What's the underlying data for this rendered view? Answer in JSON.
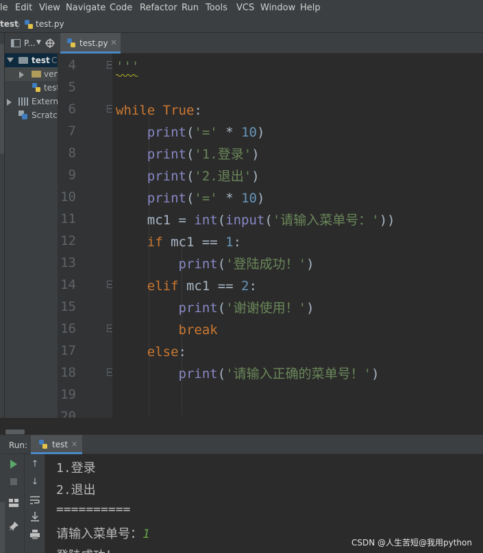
{
  "menu": [
    "le",
    "Edit",
    "View",
    "Navigate",
    "Code",
    "Refactor",
    "Run",
    "Tools",
    "VCS",
    "Window",
    "Help"
  ],
  "breadcrumb": {
    "project": "test",
    "file": "test.py"
  },
  "project_panel": {
    "header": "P...",
    "items": [
      {
        "label": "test",
        "suffix": "C",
        "level": 0,
        "expanded": true,
        "kind": "folder"
      },
      {
        "label": "ven",
        "level": 1,
        "expanded": false,
        "kind": "folder"
      },
      {
        "label": "test",
        "level": 2,
        "kind": "python-file"
      },
      {
        "label": "Extern",
        "level": 0,
        "expanded": false,
        "kind": "libraries"
      },
      {
        "label": "Scratch",
        "level": 0,
        "kind": "scratches"
      }
    ]
  },
  "editor": {
    "tab_label": "test.py",
    "lines": [
      {
        "num": "4",
        "tokens": [
          {
            "t": "'''",
            "c": "str"
          }
        ]
      },
      {
        "num": "5",
        "tokens": []
      },
      {
        "num": "6",
        "tokens": [
          {
            "t": "while ",
            "c": "kw"
          },
          {
            "t": "True",
            "c": "kw"
          },
          {
            "t": ":",
            "c": ""
          }
        ]
      },
      {
        "num": "7",
        "tokens": [
          {
            "t": "    ",
            "c": ""
          },
          {
            "t": "print",
            "c": "fn"
          },
          {
            "t": "(",
            "c": ""
          },
          {
            "t": "'='",
            "c": "str"
          },
          {
            "t": " * ",
            "c": ""
          },
          {
            "t": "10",
            "c": "num"
          },
          {
            "t": ")",
            "c": ""
          }
        ]
      },
      {
        "num": "8",
        "tokens": [
          {
            "t": "    ",
            "c": ""
          },
          {
            "t": "print",
            "c": "fn"
          },
          {
            "t": "(",
            "c": ""
          },
          {
            "t": "'1.登录'",
            "c": "str"
          },
          {
            "t": ")",
            "c": ""
          }
        ]
      },
      {
        "num": "9",
        "tokens": [
          {
            "t": "    ",
            "c": ""
          },
          {
            "t": "print",
            "c": "fn"
          },
          {
            "t": "(",
            "c": ""
          },
          {
            "t": "'2.退出'",
            "c": "str"
          },
          {
            "t": ")",
            "c": ""
          }
        ]
      },
      {
        "num": "10",
        "tokens": [
          {
            "t": "    ",
            "c": ""
          },
          {
            "t": "print",
            "c": "fn"
          },
          {
            "t": "(",
            "c": ""
          },
          {
            "t": "'='",
            "c": "str"
          },
          {
            "t": " * ",
            "c": ""
          },
          {
            "t": "10",
            "c": "num"
          },
          {
            "t": ")",
            "c": ""
          }
        ]
      },
      {
        "num": "11",
        "tokens": [
          {
            "t": "    mc1 = ",
            "c": ""
          },
          {
            "t": "int",
            "c": "fn"
          },
          {
            "t": "(",
            "c": ""
          },
          {
            "t": "input",
            "c": "fn"
          },
          {
            "t": "(",
            "c": ""
          },
          {
            "t": "'请输入菜单号：'",
            "c": "str"
          },
          {
            "t": "))",
            "c": ""
          }
        ]
      },
      {
        "num": "12",
        "tokens": [
          {
            "t": "    ",
            "c": ""
          },
          {
            "t": "if",
            "c": "kw"
          },
          {
            "t": " mc1 == ",
            "c": ""
          },
          {
            "t": "1",
            "c": "num"
          },
          {
            "t": ":",
            "c": ""
          }
        ]
      },
      {
        "num": "13",
        "tokens": [
          {
            "t": "        ",
            "c": ""
          },
          {
            "t": "print",
            "c": "fn"
          },
          {
            "t": "(",
            "c": ""
          },
          {
            "t": "'登陆成功！'",
            "c": "str"
          },
          {
            "t": ")",
            "c": ""
          }
        ]
      },
      {
        "num": "14",
        "tokens": [
          {
            "t": "    ",
            "c": ""
          },
          {
            "t": "elif",
            "c": "kw"
          },
          {
            "t": " mc1 == ",
            "c": ""
          },
          {
            "t": "2",
            "c": "num"
          },
          {
            "t": ":",
            "c": ""
          }
        ]
      },
      {
        "num": "15",
        "tokens": [
          {
            "t": "        ",
            "c": ""
          },
          {
            "t": "print",
            "c": "fn"
          },
          {
            "t": "(",
            "c": ""
          },
          {
            "t": "'谢谢使用！'",
            "c": "str"
          },
          {
            "t": ")",
            "c": ""
          }
        ]
      },
      {
        "num": "16",
        "tokens": [
          {
            "t": "        ",
            "c": ""
          },
          {
            "t": "break",
            "c": "kw"
          }
        ]
      },
      {
        "num": "17",
        "tokens": [
          {
            "t": "    ",
            "c": ""
          },
          {
            "t": "else",
            "c": "kw"
          },
          {
            "t": ":",
            "c": ""
          }
        ]
      },
      {
        "num": "18",
        "tokens": [
          {
            "t": "        ",
            "c": ""
          },
          {
            "t": "print",
            "c": "fn"
          },
          {
            "t": "(",
            "c": ""
          },
          {
            "t": "'请输入正确的菜单号！'",
            "c": "str"
          },
          {
            "t": ")",
            "c": ""
          }
        ]
      },
      {
        "num": "19",
        "tokens": []
      },
      {
        "num": "20",
        "tokens": []
      }
    ]
  },
  "run_panel": {
    "label": "Run:",
    "tab_label": "test",
    "output": [
      {
        "text": "1.登录"
      },
      {
        "text": "2.退出"
      },
      {
        "text": "=========="
      },
      {
        "text": "请输入菜单号：",
        "input": "1"
      },
      {
        "text": "登陆成功！"
      }
    ]
  },
  "watermark": "CSDN @人生苦短@我用python",
  "colors": {
    "keyword": "#cc7832",
    "builtin": "#8888c6",
    "string": "#6a8759",
    "number": "#6897bb",
    "user_input": "#62a042",
    "panel_bg": "#3c3f41",
    "editor_bg": "#2b2b2b"
  }
}
